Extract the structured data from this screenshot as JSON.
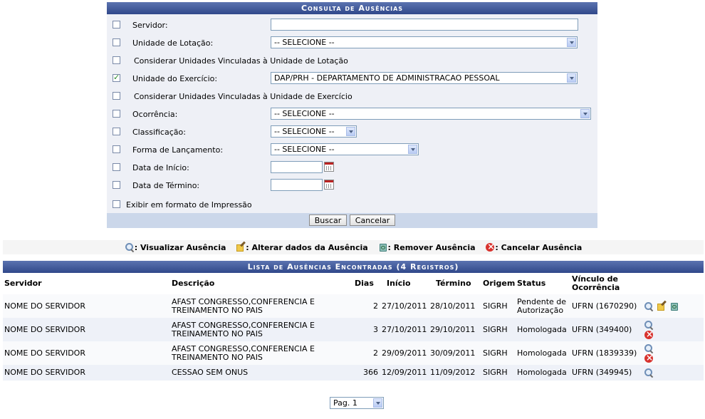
{
  "form": {
    "title": "Consulta de Ausências",
    "fields": {
      "servidor": {
        "label": "Servidor:",
        "value": ""
      },
      "unidade_lotacao": {
        "label": "Unidade de Lotação:",
        "selected": "-- SELECIONE --"
      },
      "considerar_lotacao": {
        "label": "Considerar Unidades Vinculadas à Unidade de Lotação"
      },
      "unidade_exercicio": {
        "label": "Unidade do Exercício:",
        "selected": "DAP/PRH - DEPARTAMENTO DE ADMINISTRACAO PESSOAL",
        "checked": true
      },
      "considerar_exercicio": {
        "label": "Considerar Unidades Vinculadas à Unidade de Exercício"
      },
      "ocorrencia": {
        "label": "Ocorrência:",
        "selected": "-- SELECIONE --"
      },
      "classificacao": {
        "label": "Classificação:",
        "selected": "-- SELECIONE --"
      },
      "forma_lancamento": {
        "label": "Forma de Lançamento:",
        "selected": "-- SELECIONE --"
      },
      "data_inicio": {
        "label": "Data de Início:",
        "value": ""
      },
      "data_termino": {
        "label": "Data de Término:",
        "value": ""
      },
      "impressao": {
        "label": "Exibir em formato de Impressão"
      }
    },
    "buttons": {
      "buscar": "Buscar",
      "cancelar": "Cancelar"
    }
  },
  "legend": {
    "visualizar": ": Visualizar Ausência",
    "alterar": ": Alterar dados da Ausência",
    "remover": ": Remover Ausência",
    "cancelar": ": Cancelar Ausência"
  },
  "results": {
    "title": "Lista de Ausências Encontradas (4 Registros)",
    "columns": {
      "servidor": "Servidor",
      "descricao": "Descrição",
      "dias": "Dias",
      "inicio": "Início",
      "termino": "Término",
      "origem": "Origem",
      "status": "Status",
      "vinculo": "Vínculo de Ocorrência"
    },
    "rows": [
      {
        "servidor": "NOME DO SERVIDOR",
        "descricao": "AFAST CONGRESSO,CONFERENCIA E TREINAMENTO NO PAIS",
        "dias": "2",
        "inicio": "27/10/2011",
        "termino": "28/10/2011",
        "origem": "SIGRH",
        "status": "Pendente de Autorização",
        "vinculo": "UFRN (1670290)"
      },
      {
        "servidor": "NOME DO SERVIDOR",
        "descricao": "AFAST CONGRESSO,CONFERENCIA E TREINAMENTO NO PAIS",
        "dias": "3",
        "inicio": "27/10/2011",
        "termino": "29/10/2011",
        "origem": "SIGRH",
        "status": "Homologada",
        "vinculo": "UFRN (349400)"
      },
      {
        "servidor": "NOME DO SERVIDOR",
        "descricao": "AFAST CONGRESSO,CONFERENCIA E TREINAMENTO NO PAIS",
        "dias": "2",
        "inicio": "29/09/2011",
        "termino": "30/09/2011",
        "origem": "SIGRH",
        "status": "Homologada",
        "vinculo": "UFRN (1839339)"
      },
      {
        "servidor": "NOME DO SERVIDOR",
        "descricao": "CESSAO SEM ONUS",
        "dias": "366",
        "inicio": "12/09/2011",
        "termino": "11/09/2012",
        "origem": "SIGRH",
        "status": "Homologada",
        "vinculo": "UFRN (349945)"
      }
    ]
  },
  "pager": {
    "selected": "Pag. 1"
  }
}
